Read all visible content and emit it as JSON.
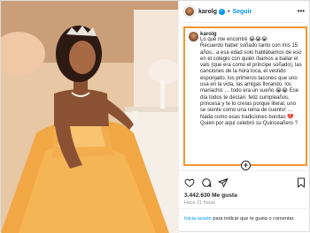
{
  "post": {
    "username": "karolg",
    "verified_mark": "✓",
    "dot": "•",
    "follow_label": "Seguir",
    "more_label": "•••",
    "caption": {
      "username": "karolg",
      "text": "Lo que me encontré 😭😭😭\nRecuerdo haber soñado tanto con mis 15 años.. a esa edad solo hablábamos de eso en el colegio con quién íbamos a bailar el vals (que era como el príncipe soñado), las canciones de la hora loca, el vestido esponjado, los primeros tacones que uno usa en la vida, las amigas llorando, los mariachis … todo era un sueño 😭😭 Ese día todos te decían: feliz cumpleaños, princesa y te lo creías porque literal, uno se siente como una reina de cuento! … Nada como esas tradiciones bonitas 💔 Quien por aquí celebró su Quinceañero ?"
    },
    "add_comment_symbol": "+",
    "likes": "3.442.630 Me gusta",
    "time_ago": "Hace 21 horas",
    "login_prompt": {
      "link": "Inicia sesión",
      "rest": " para indicar que te gusta o comentar."
    },
    "icons": {
      "like": "heart-icon",
      "comment": "comment-icon",
      "share": "share-icon",
      "save": "bookmark-icon"
    },
    "colors": {
      "highlight_border": "#f2962d",
      "link_blue": "#0095f6"
    }
  }
}
